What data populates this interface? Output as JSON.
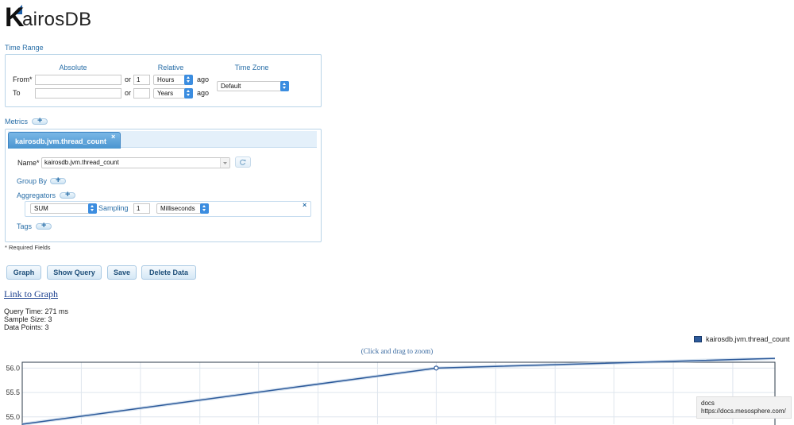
{
  "logo": {
    "initial": "K",
    "rest": "airosDB"
  },
  "time_range": {
    "section_label": "Time Range",
    "headers": {
      "absolute": "Absolute",
      "relative": "Relative",
      "timezone": "Time Zone"
    },
    "from_label": "From*",
    "to_label": "To",
    "or_label": "or",
    "ago_label": "ago",
    "from_absolute": "",
    "to_absolute": "",
    "from_relative_value": "1",
    "to_relative_value": "",
    "from_relative_unit": "Hours",
    "to_relative_unit": "Years",
    "timezone_value": "Default"
  },
  "metrics": {
    "section_label": "Metrics",
    "tab_label": "kairosdb.jvm.thread_count",
    "close_symbol": "×",
    "name_label": "Name*",
    "name_value": "kairosdb.jvm.thread_count",
    "group_by_label": "Group By",
    "aggregators_label": "Aggregators",
    "aggregator": {
      "function": "SUM",
      "sampling_label": "Sampling",
      "sampling_value": "1",
      "sampling_unit": "Milliseconds",
      "close_symbol": "×"
    },
    "tags_label": "Tags"
  },
  "required_note": "* Required Fields",
  "buttons": {
    "graph": "Graph",
    "show_query": "Show Query",
    "save": "Save",
    "delete_data": "Delete Data"
  },
  "link_to_graph": "Link to Graph",
  "stats": {
    "query_time_label": "Query Time:",
    "query_time_value": "271 ms",
    "sample_size_label": "Sample Size:",
    "sample_size_value": "3",
    "data_points_label": "Data Points:",
    "data_points_value": "3"
  },
  "tooltip": {
    "title": "docs",
    "url": "https://docs.mesosphere.com/"
  },
  "colors": {
    "accent": "#2a6fa8",
    "series": "#2d5a9a"
  },
  "chart_data": {
    "type": "line",
    "subtitle": "(Click and drag to zoom)",
    "series": [
      {
        "name": "kairosdb.jvm.thread_count",
        "values": [
          54.85,
          56.0,
          56.2
        ]
      }
    ],
    "x": [
      0,
      0.55,
      1.0
    ],
    "y_ticks": [
      "56.0",
      "55.5",
      "55.0"
    ],
    "ylim": [
      54.85,
      56.12
    ],
    "grid": true,
    "legend_position": "top-right"
  }
}
